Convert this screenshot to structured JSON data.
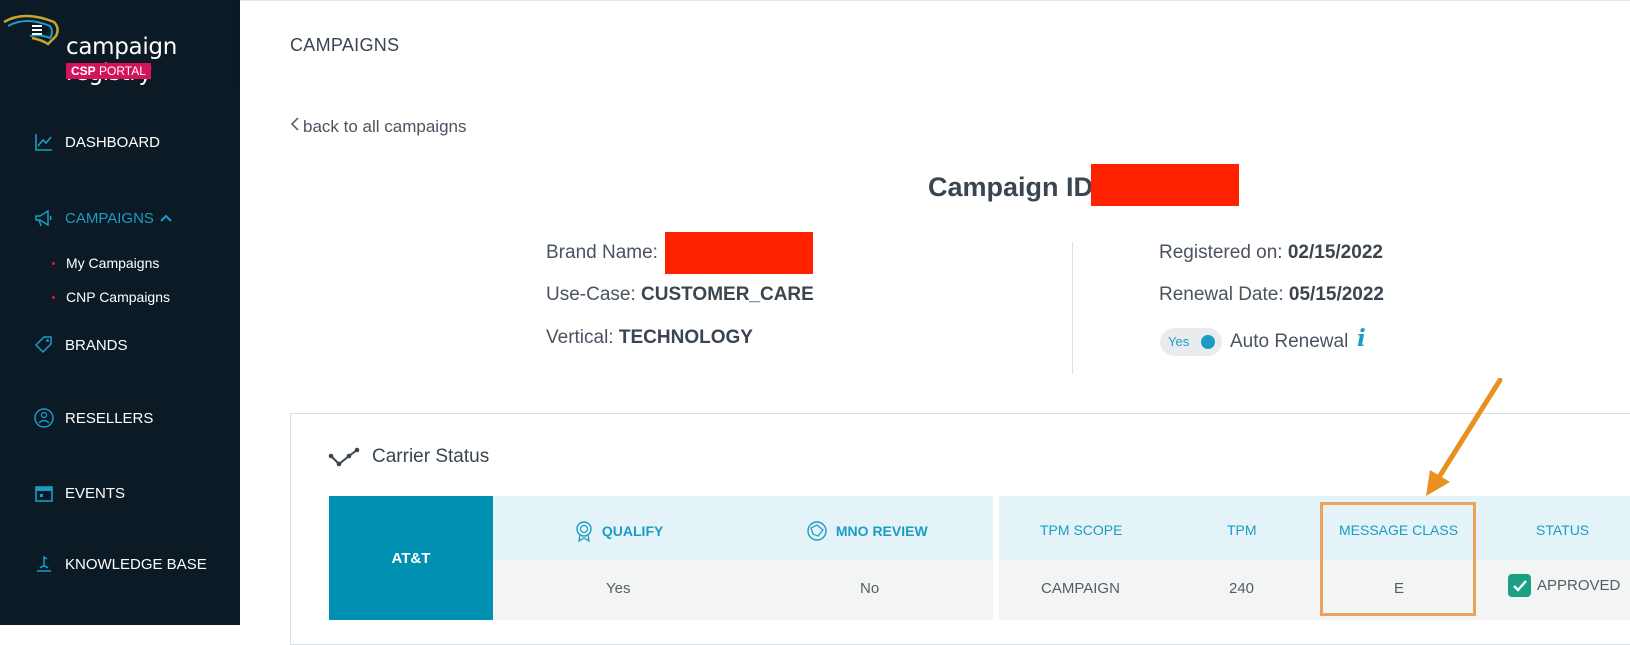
{
  "app": {
    "logo_title": "campaign registry",
    "logo_sub_bold": "CSP",
    "logo_sub_rest": " PORTAL"
  },
  "sidebar": {
    "items": [
      {
        "label": "DASHBOARD",
        "icon": "chart-line-icon"
      },
      {
        "label": "CAMPAIGNS",
        "icon": "megaphone-icon",
        "active": true
      },
      {
        "label": "BRANDS",
        "icon": "tag-icon"
      },
      {
        "label": "RESELLERS",
        "icon": "reseller-icon"
      },
      {
        "label": "EVENTS",
        "icon": "calendar-icon"
      },
      {
        "label": "KNOWLEDGE BASE",
        "icon": "knowledge-icon"
      }
    ],
    "sub_items": [
      {
        "label": "My Campaigns"
      },
      {
        "label": "CNP Campaigns"
      }
    ]
  },
  "header": {
    "title": "CAMPAIGNS"
  },
  "main": {
    "back_link": "back to all campaigns",
    "campaign_id_label": "Campaign ID:",
    "brand_name_label": "Brand Name:",
    "use_case_label": "Use-Case:",
    "use_case_value": "CUSTOMER_CARE",
    "vertical_label": "Vertical:",
    "vertical_value": "TECHNOLOGY",
    "registered_label": "Registered on:",
    "registered_value": "02/15/2022",
    "renewal_label": "Renewal Date:",
    "renewal_value": "05/15/2022",
    "auto_renewal_toggle": "Yes",
    "auto_renewal_label": "Auto Renewal",
    "info_icon_glyph": "i"
  },
  "carrier_status": {
    "title": "Carrier Status",
    "carrier": "AT&T",
    "columns": [
      "QUALIFY",
      "MNO REVIEW",
      "TPM SCOPE",
      "TPM",
      "MESSAGE CLASS",
      "STATUS"
    ],
    "row": [
      "Yes",
      "No",
      "CAMPAIGN",
      "240",
      "E",
      "APPROVED"
    ]
  },
  "colors": {
    "sidebar_bg": "#0b1a24",
    "accent": "#1b9cc4",
    "brand_pink": "#d4145a",
    "carrier_cell": "#0090b1",
    "highlight": "#e9a35a",
    "redaction": "#ff2200",
    "approved": "#1aa085"
  }
}
